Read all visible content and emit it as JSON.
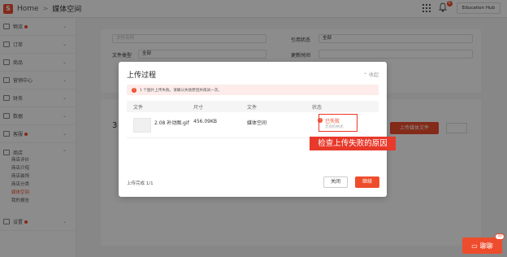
{
  "header": {
    "logo_glyph": "S",
    "home_label": "Home",
    "separator": ">",
    "current_label": "媒体空间",
    "notification_count": "6",
    "user_label": "Education Hub"
  },
  "sidebar": {
    "groups": [
      {
        "label": "物流",
        "icon": "truck-icon",
        "badge": true
      },
      {
        "label": "订单",
        "icon": "order-icon",
        "badge": false
      },
      {
        "label": "商品",
        "icon": "product-icon",
        "badge": false
      },
      {
        "label": "营销中心",
        "icon": "marketing-icon",
        "badge": false
      },
      {
        "label": "财务",
        "icon": "finance-icon",
        "badge": false
      },
      {
        "label": "数据",
        "icon": "data-icon",
        "badge": false
      },
      {
        "label": "客服",
        "icon": "service-icon",
        "badge": true
      },
      {
        "label": "商店",
        "icon": "shop-icon",
        "badge": false
      },
      {
        "label": "设置",
        "icon": "settings-icon",
        "badge": true
      }
    ],
    "shop_sub_items": [
      "商店评价",
      "商店介绍",
      "商店装饰",
      "商店分类",
      "媒体空间",
      "我的报告"
    ],
    "active_sub_item": "媒体空间"
  },
  "filters": {
    "name_placeholder": "文件名称",
    "reference_status_label": "引用状态",
    "reference_status_value": "全部",
    "file_type_label": "文件类型",
    "file_type_value": "全部",
    "update_time_label": "更新时间"
  },
  "background": {
    "list_count": "3",
    "upload_button": "上传媒体文件"
  },
  "modal": {
    "title": "上传过程",
    "collapse_label": "收起",
    "alert_text": "1 个图片上传失败。请确认失败原因并再试一次。",
    "columns": [
      "文件",
      "尺寸",
      "文件",
      "状态"
    ],
    "row": {
      "file_name": "2.08 补动图.gif",
      "size": "456.09KB",
      "location": "媒体空间",
      "status": "已失败",
      "reason": "无效的格式"
    },
    "footer_progress": "上传完成 1/1",
    "close_button": "关闭",
    "continue_button": "继续"
  },
  "annotation": {
    "text": "检查上传失败的原因"
  },
  "chat": {
    "label": "聊聊",
    "count": "32"
  },
  "colors": {
    "brand": "#ee4d2d",
    "annotation": "#e8392a"
  }
}
